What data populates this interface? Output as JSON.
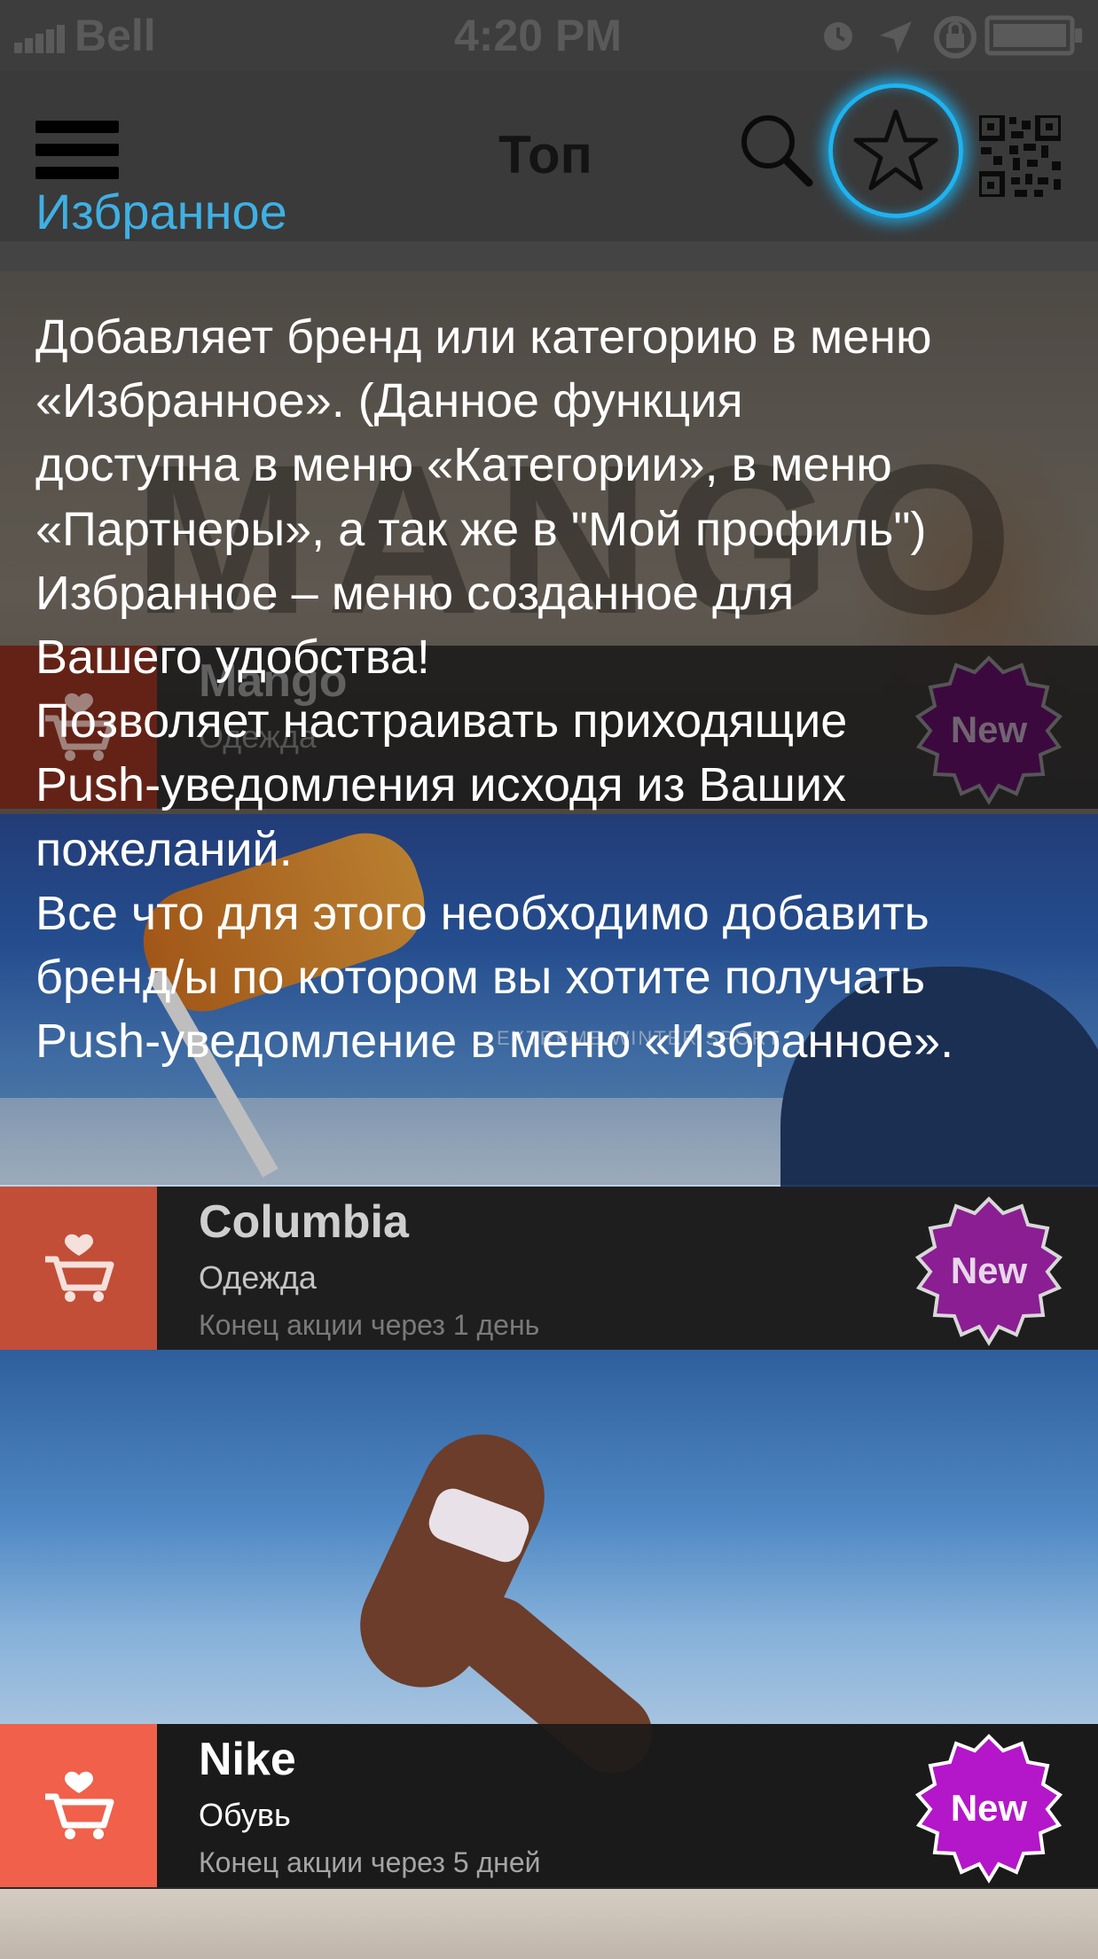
{
  "status_bar": {
    "carrier": "Bell",
    "time": "4:20 PM"
  },
  "nav": {
    "title": "Топ",
    "favorites_label": "Избранное",
    "menu_icon": "hamburger-icon",
    "search_icon": "search-icon",
    "star_icon": "star-icon",
    "qr_icon": "qr-code-icon",
    "accent_color": "#3fb0e4",
    "highlight_color": "#1fb3f0"
  },
  "tooltip": {
    "lines": [
      "Добавляет бренд или категорию в меню",
      "«Избранное». (Данное функция",
      "доступна в меню «Категории», в меню",
      "«Партнеры», а так же в \"Мой профиль\")",
      "Избранное – меню созданное для",
      "Вашего удобства!",
      "Позволяет настраивать приходящие",
      "Push-уведомления исходя из Ваших",
      "пожеланий.",
      "Все что для этого необходимо добавить",
      "бренд/ы по котором вы хотите получать",
      "Push-уведомление в меню «Избранное»."
    ]
  },
  "cards": [
    {
      "hero_word": "MANGO",
      "name": "Mango",
      "category": "Одежда",
      "end_text": "",
      "badge": "New",
      "icon_color": "#7a2a1c",
      "badge_color": "#4a0c4e"
    },
    {
      "hero_word": "EXTREME WINTER SPORT",
      "name": "Columbia",
      "category": "Одежда",
      "end_text": "Конец акции через 1 день",
      "badge": "New",
      "icon_color": "#c24e37",
      "badge_color": "#8a1e92"
    },
    {
      "name": "Nike",
      "category": "Обувь",
      "end_text": "Конец акции через 5 дней",
      "badge": "New",
      "icon_color": "#f0604a",
      "badge_color": "#b416c9"
    }
  ],
  "cart_icon": "cart-heart-icon",
  "badge_icon": "starburst-badge-icon"
}
